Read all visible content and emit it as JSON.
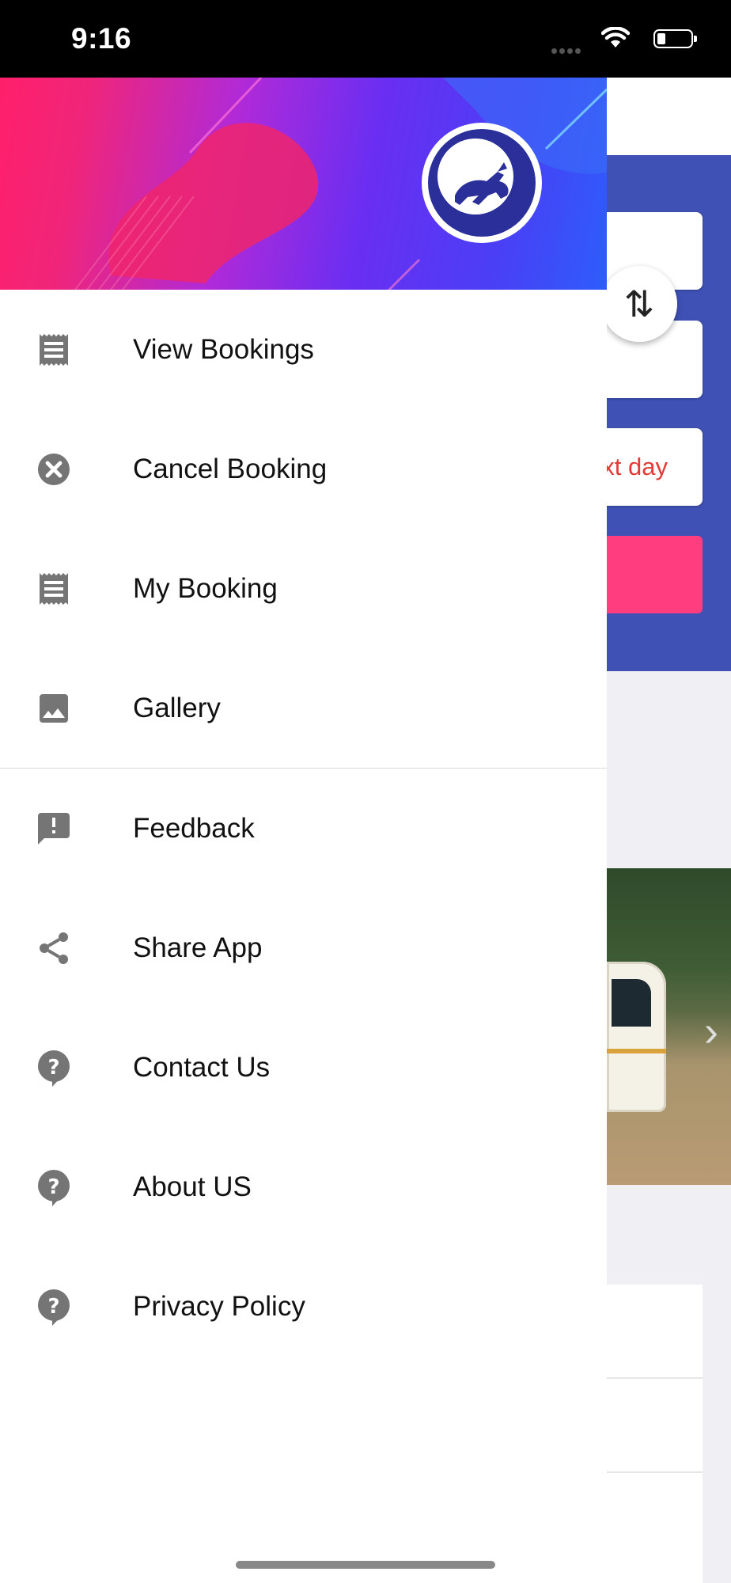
{
  "status_bar": {
    "time": "9:16"
  },
  "background": {
    "date_field_text": "ext day",
    "swap_symbol": "⇅"
  },
  "drawer": {
    "menu_primary": [
      {
        "label": "View Bookings",
        "icon": "receipt-icon"
      },
      {
        "label": "Cancel Booking",
        "icon": "cancel-circle-icon"
      },
      {
        "label": "My Booking",
        "icon": "receipt-icon"
      },
      {
        "label": "Gallery",
        "icon": "image-icon"
      }
    ],
    "menu_secondary": [
      {
        "label": "Feedback",
        "icon": "feedback-icon"
      },
      {
        "label": "Share App",
        "icon": "share-icon"
      },
      {
        "label": "Contact Us",
        "icon": "help-icon"
      },
      {
        "label": "About US",
        "icon": "help-icon"
      },
      {
        "label": "Privacy Policy",
        "icon": "help-icon"
      }
    ]
  },
  "colors": {
    "header_gradient_start": "#ff1f6a",
    "header_gradient_end": "#2d5dfb",
    "background_primary": "#3f51b5",
    "accent_pink": "#ff3d7f",
    "icon_gray": "#757575"
  }
}
